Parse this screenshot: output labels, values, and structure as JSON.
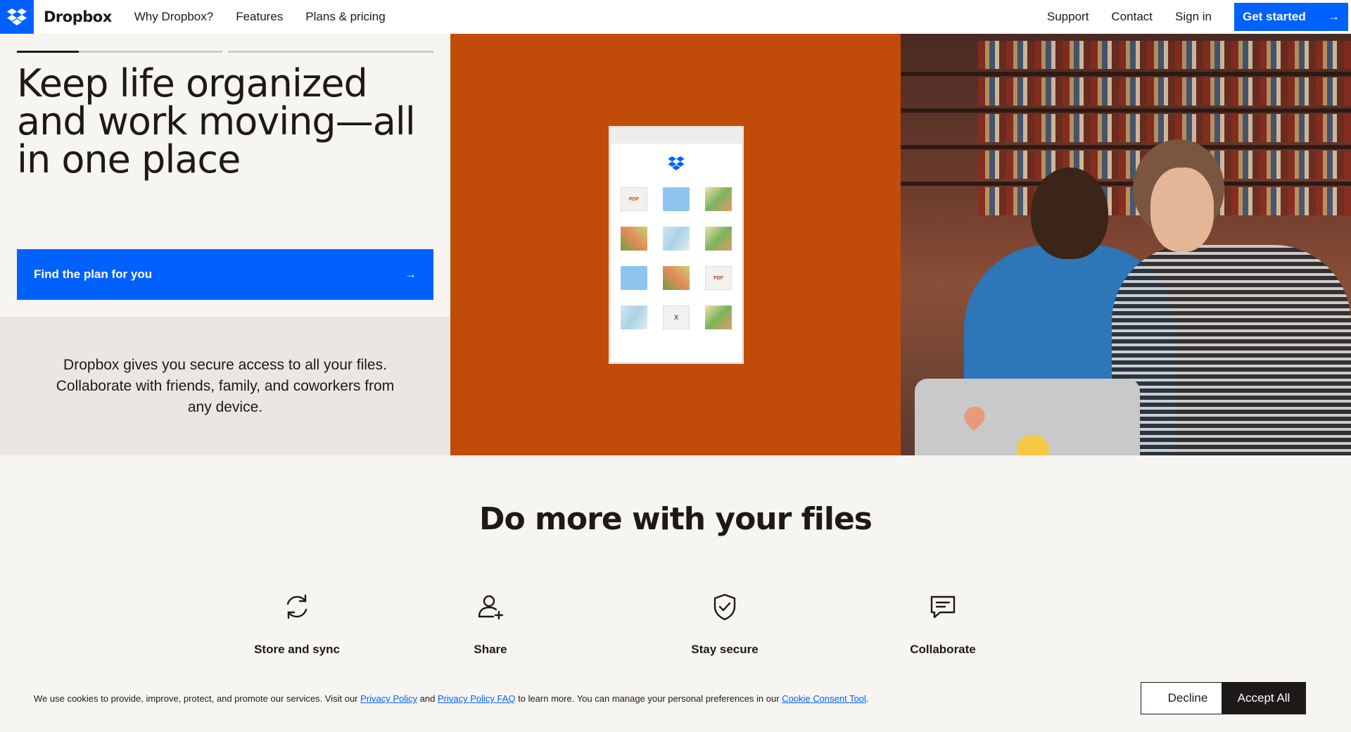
{
  "header": {
    "brand": "Dropbox",
    "nav": [
      "Why Dropbox?",
      "Features",
      "Plans & pricing"
    ],
    "right": [
      "Support",
      "Contact",
      "Sign in"
    ],
    "cta": "Get started",
    "brand_color": "#0061fe"
  },
  "hero": {
    "title": "Keep life organized and work moving—all in one place",
    "button": "Find the plan for you",
    "description": "Dropbox gives you secure access to all your files. Collaborate with friends, family, and coworkers from any device.",
    "panel_color": "#c14c0a",
    "slide_progress": [
      0.3,
      0,
      0
    ]
  },
  "device_tiles": [
    {
      "type": "pdf",
      "label": "PDF"
    },
    {
      "type": "folder",
      "label": ""
    },
    {
      "type": "image",
      "label": ""
    },
    {
      "type": "image",
      "label": ""
    },
    {
      "type": "image",
      "label": ""
    },
    {
      "type": "image",
      "label": ""
    },
    {
      "type": "folder",
      "label": ""
    },
    {
      "type": "image",
      "label": ""
    },
    {
      "type": "pdf",
      "label": "PDF"
    },
    {
      "type": "image",
      "label": ""
    },
    {
      "type": "xls",
      "label": "X"
    },
    {
      "type": "image",
      "label": ""
    }
  ],
  "features": {
    "title": "Do more with your files",
    "items": [
      {
        "label": "Store and sync",
        "icon": "sync-icon"
      },
      {
        "label": "Share",
        "icon": "add-user-icon"
      },
      {
        "label": "Stay secure",
        "icon": "shield-check-icon"
      },
      {
        "label": "Collaborate",
        "icon": "chat-icon"
      }
    ]
  },
  "cookie": {
    "text_before": "We use cookies to provide, improve, protect, and promote our services. Visit our ",
    "link1": "Privacy Policy",
    "and": " and ",
    "link2": "Privacy Policy FAQ",
    "text_middle": " to learn more. You can manage your personal preferences in our ",
    "link3": "Cookie Consent Tool",
    "text_end": ".",
    "decline": "Decline",
    "accept": "Accept All"
  }
}
